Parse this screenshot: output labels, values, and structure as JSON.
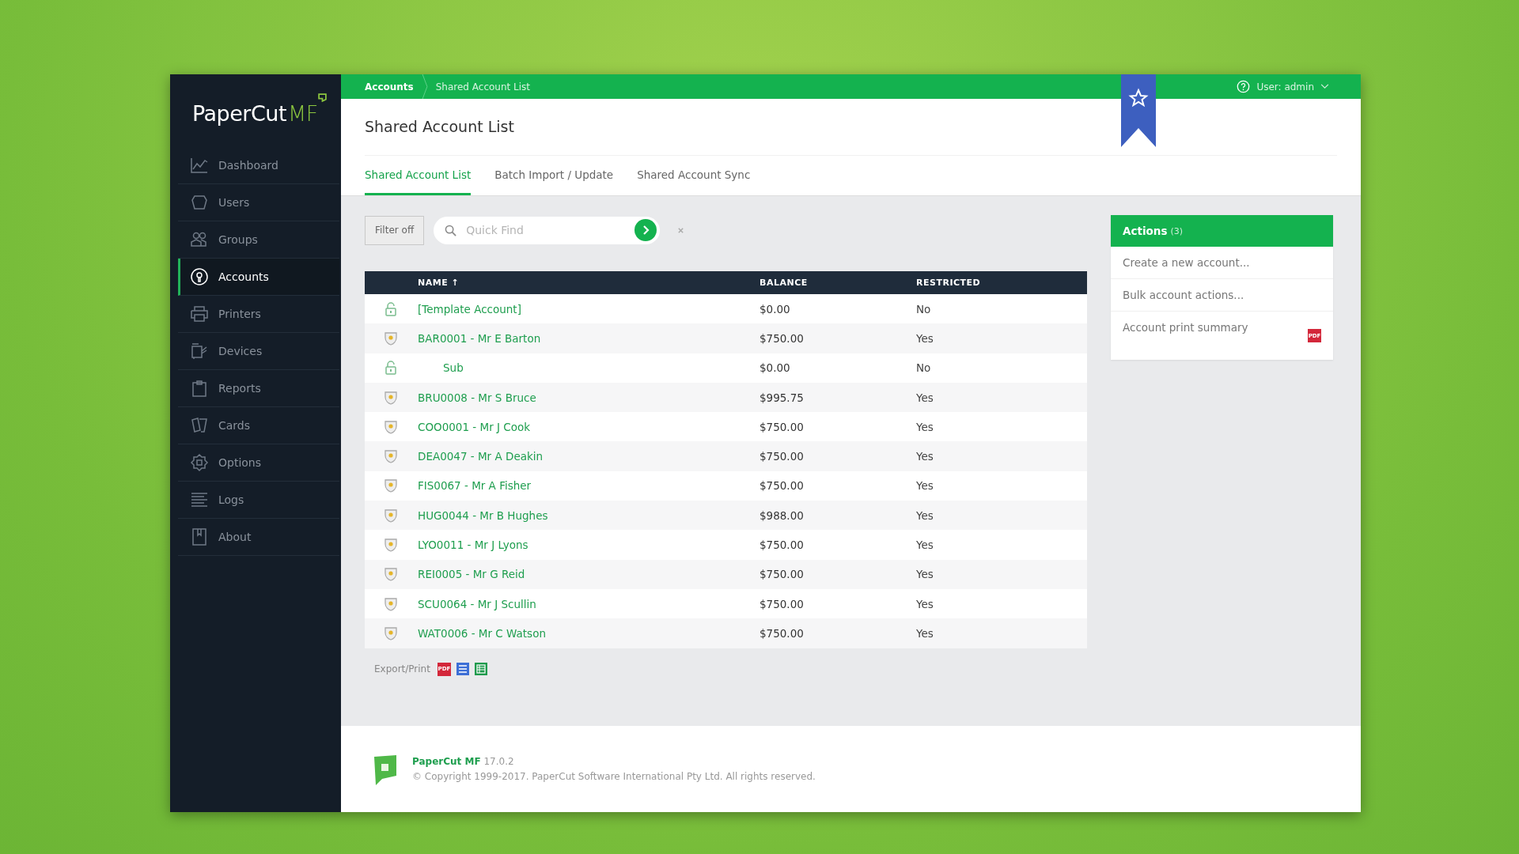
{
  "brand": {
    "name": "PaperCut",
    "suffix": "MF"
  },
  "sidebar": {
    "items": [
      {
        "label": "Dashboard",
        "selected": false
      },
      {
        "label": "Users",
        "selected": false
      },
      {
        "label": "Groups",
        "selected": false
      },
      {
        "label": "Accounts",
        "selected": true
      },
      {
        "label": "Printers",
        "selected": false
      },
      {
        "label": "Devices",
        "selected": false
      },
      {
        "label": "Reports",
        "selected": false
      },
      {
        "label": "Cards",
        "selected": false
      },
      {
        "label": "Options",
        "selected": false
      },
      {
        "label": "Logs",
        "selected": false
      },
      {
        "label": "About",
        "selected": false
      }
    ]
  },
  "breadcrumb": [
    "Accounts",
    "Shared Account List"
  ],
  "user_menu": "User: admin",
  "page_title": "Shared Account List",
  "tabs": [
    {
      "label": "Shared Account List",
      "selected": true
    },
    {
      "label": "Batch Import / Update",
      "selected": false
    },
    {
      "label": "Shared Account Sync",
      "selected": false
    }
  ],
  "filter_button": "Filter off",
  "search": {
    "placeholder": "Quick Find"
  },
  "table": {
    "columns": [
      "NAME ↑",
      "BALANCE",
      "RESTRICTED"
    ],
    "rows": [
      {
        "kind": "lock",
        "name": "[Template Account]",
        "balance": "$0.00",
        "restricted": "No"
      },
      {
        "kind": "shield",
        "name": "BAR0001 - Mr E Barton",
        "balance": "$750.00",
        "restricted": "Yes",
        "children": [
          {
            "kind": "lock",
            "name": "Sub",
            "balance": "$0.00",
            "restricted": "No"
          }
        ]
      },
      {
        "kind": "shield",
        "name": "BRU0008 - Mr S Bruce",
        "balance": "$995.75",
        "restricted": "Yes"
      },
      {
        "kind": "shield",
        "name": "COO0001 - Mr J Cook",
        "balance": "$750.00",
        "restricted": "Yes"
      },
      {
        "kind": "shield",
        "name": "DEA0047 - Mr A Deakin",
        "balance": "$750.00",
        "restricted": "Yes"
      },
      {
        "kind": "shield",
        "name": "FIS0067 - Mr A Fisher",
        "balance": "$750.00",
        "restricted": "Yes"
      },
      {
        "kind": "shield",
        "name": "HUG0044 - Mr B Hughes",
        "balance": "$988.00",
        "restricted": "Yes"
      },
      {
        "kind": "shield",
        "name": "LYO0011 - Mr J Lyons",
        "balance": "$750.00",
        "restricted": "Yes"
      },
      {
        "kind": "shield",
        "name": "REI0005 - Mr G Reid",
        "balance": "$750.00",
        "restricted": "Yes"
      },
      {
        "kind": "shield",
        "name": "SCU0064 - Mr J Scullin",
        "balance": "$750.00",
        "restricted": "Yes"
      },
      {
        "kind": "shield",
        "name": "WAT0006 - Mr C Watson",
        "balance": "$750.00",
        "restricted": "Yes"
      }
    ]
  },
  "export": {
    "label": "Export/Print",
    "items": [
      {
        "kind": "pdf",
        "text": "PDF"
      },
      {
        "kind": "list"
      },
      {
        "kind": "sheet"
      }
    ]
  },
  "actions": {
    "title": "Actions",
    "count": "(3)",
    "items": [
      {
        "label": "Create a new account..."
      },
      {
        "label": "Bulk account actions..."
      },
      {
        "label": "Account print summary",
        "badge": "PDF"
      }
    ]
  },
  "footer": {
    "product": "PaperCut MF",
    "version": "17.0.2",
    "copyright": "© Copyright 1999-2017. PaperCut Software International Pty Ltd. All rights reserved."
  }
}
